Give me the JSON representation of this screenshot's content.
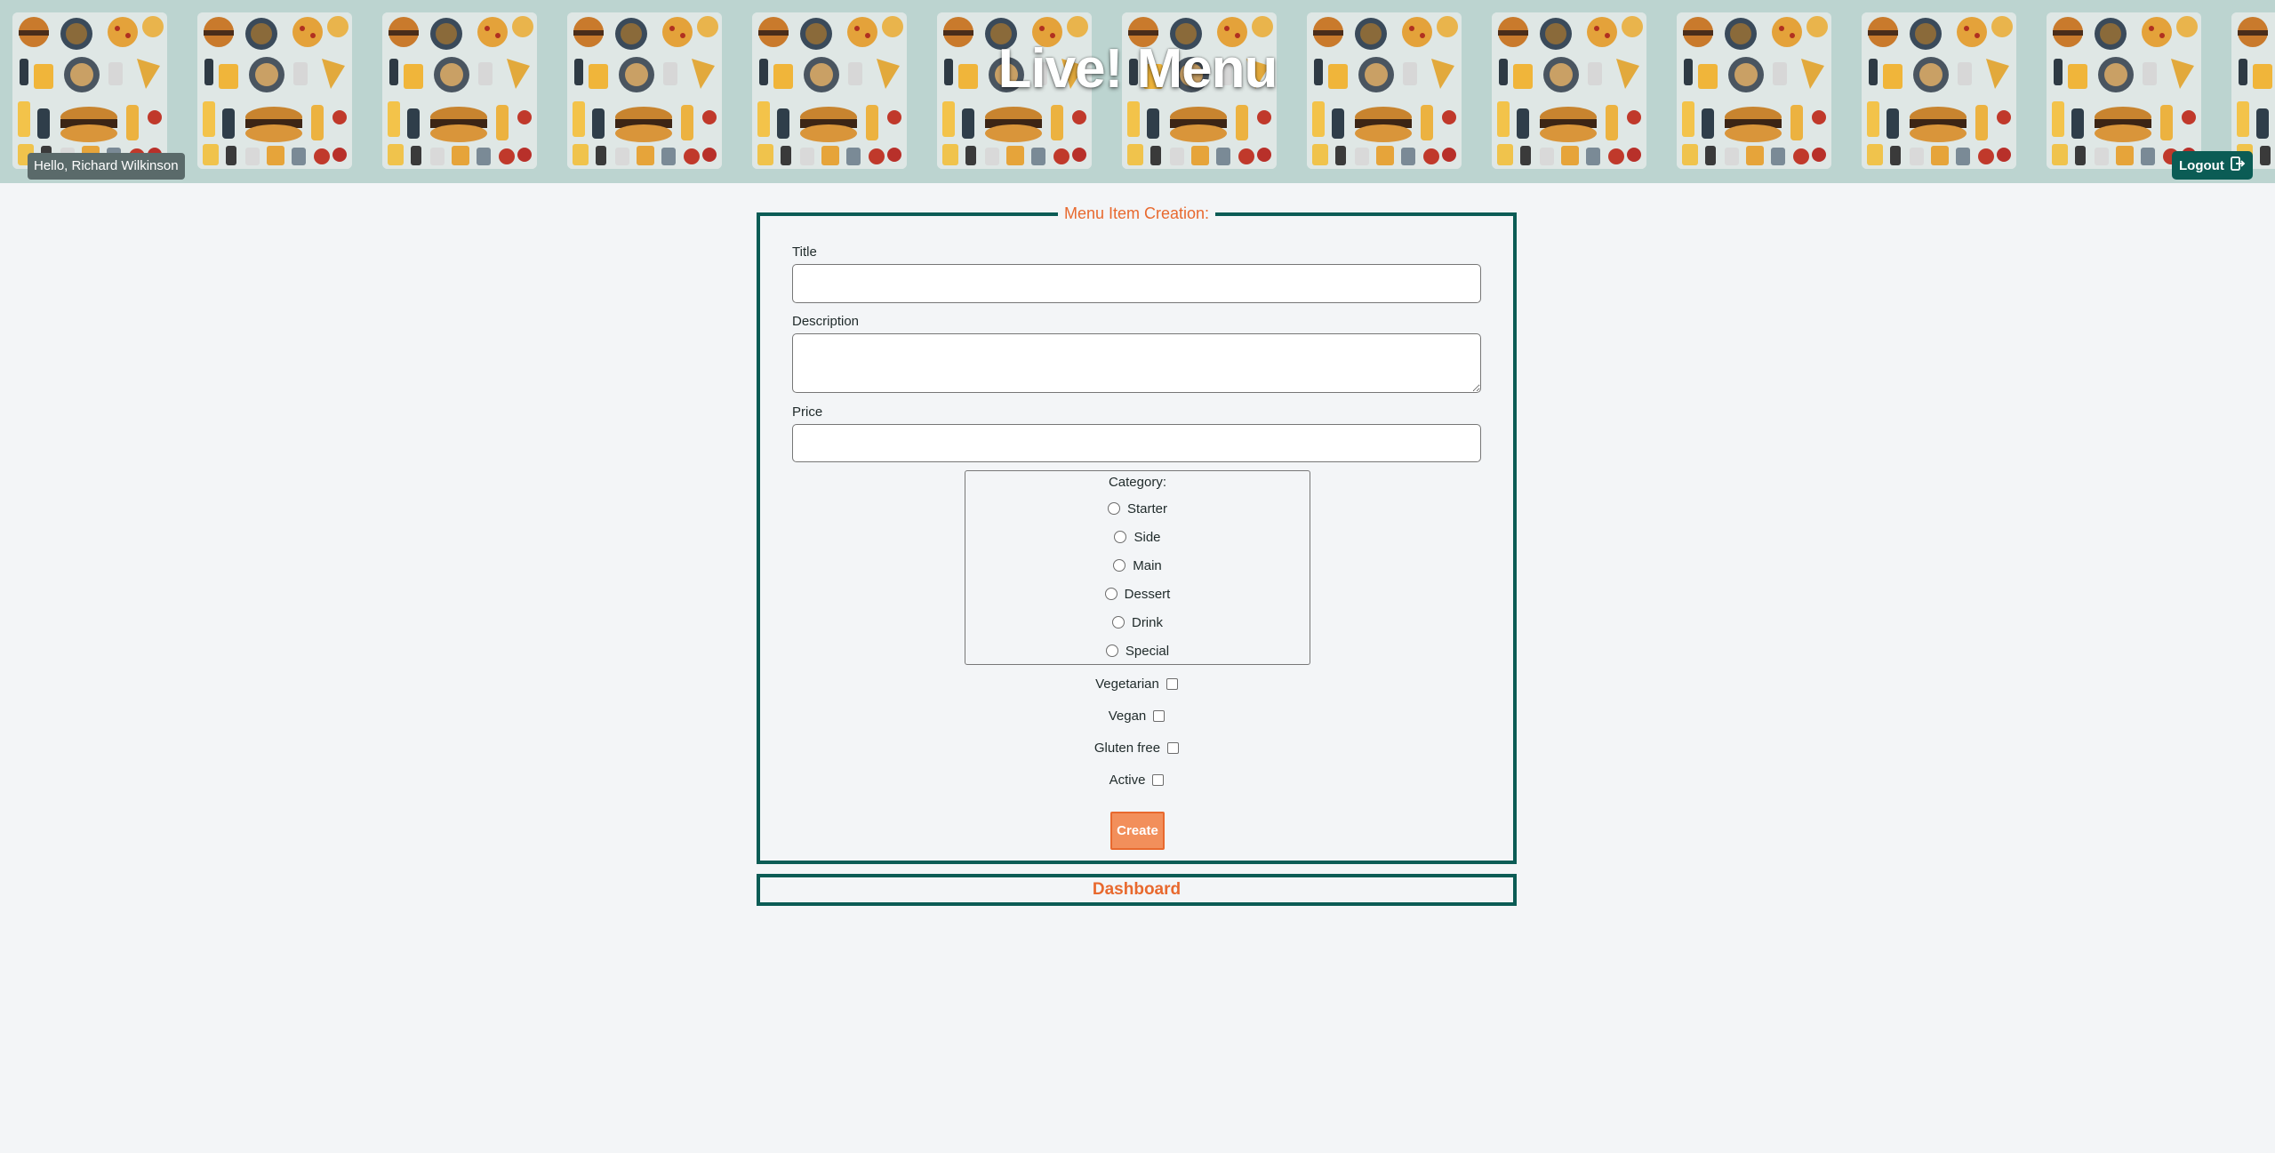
{
  "header": {
    "title": "Live! Menu",
    "greeting": "Hello, Richard Wilkinson",
    "logout_label": "Logout",
    "background_color": "#bcd4d0",
    "tile_count": 13
  },
  "form": {
    "legend": "Menu Item Creation:",
    "title_label": "Title",
    "title_value": "",
    "description_label": "Description",
    "description_value": "",
    "price_label": "Price",
    "price_value": "",
    "category": {
      "label": "Category:",
      "options": [
        "Starter",
        "Side",
        "Main",
        "Dessert",
        "Drink",
        "Special"
      ],
      "selected": null
    },
    "flags": [
      {
        "label": "Vegetarian",
        "checked": false
      },
      {
        "label": "Vegan",
        "checked": false
      },
      {
        "label": "Gluten free",
        "checked": false
      },
      {
        "label": "Active",
        "checked": false
      }
    ],
    "submit_label": "Create"
  },
  "dashboard_label": "Dashboard",
  "colors": {
    "accent": "#e8692e",
    "primary": "#0b5c55",
    "button_fill": "#f28f5b",
    "page_background": "#f3f5f7"
  },
  "icons": {
    "logout": "logout-icon",
    "header_tile": "food-pattern-icon"
  }
}
